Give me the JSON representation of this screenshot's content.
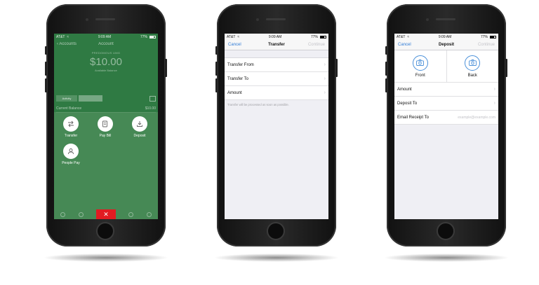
{
  "status": {
    "carrier": "AT&T",
    "time": "9:09 AM",
    "battery": "77%"
  },
  "phone1": {
    "nav": {
      "back_label": "Accounts",
      "title": "Account"
    },
    "account_name": "PREDOMOUS UMG",
    "balance": "$10.00",
    "available_label": "Available Balance",
    "tabs": [
      "Activity",
      ""
    ],
    "current_balance_label": "Current Balance",
    "current_balance_value": "$10.00",
    "actions": [
      {
        "label": "Transfer",
        "icon": "transfer-icon"
      },
      {
        "label": "Pay Bill",
        "icon": "pay-bill-icon"
      },
      {
        "label": "Deposit",
        "icon": "deposit-icon"
      },
      {
        "label": "People Pay",
        "icon": "person-icon"
      }
    ],
    "close_icon": "close-icon",
    "colors": {
      "bg": "#2f7a43",
      "close": "#e21b22"
    }
  },
  "phone2": {
    "nav": {
      "cancel": "Cancel",
      "title": "Transfer",
      "continue": "Continue"
    },
    "rows": [
      {
        "label": "Transfer From"
      },
      {
        "label": "Transfer To"
      },
      {
        "label": "Amount"
      }
    ],
    "note": "Transfer will be processed as soon as possible."
  },
  "phone3": {
    "nav": {
      "cancel": "Cancel",
      "title": "Deposit",
      "continue": "Continue"
    },
    "photos": [
      {
        "label": "Front",
        "icon": "camera-icon"
      },
      {
        "label": "Back",
        "icon": "camera-icon"
      }
    ],
    "rows": [
      {
        "label": "Amount"
      },
      {
        "label": "Deposit To"
      }
    ],
    "email": {
      "label": "Email Receipt To",
      "placeholder": "example@example.com"
    },
    "colors": {
      "link": "#2f7bd6",
      "camera": "#4a90d9"
    }
  }
}
